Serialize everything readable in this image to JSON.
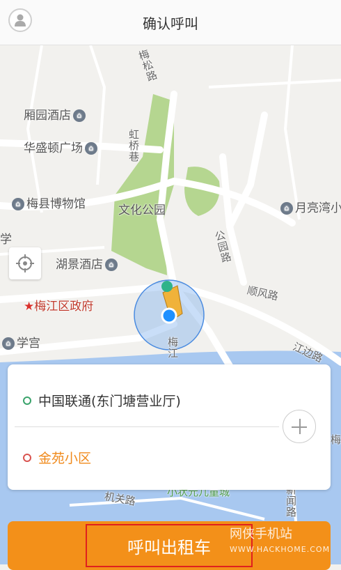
{
  "header": {
    "title": "确认呼叫",
    "avatar_icon": "user-icon"
  },
  "map": {
    "pois": [
      {
        "label": "厢园酒店",
        "icon": "hotel-icon"
      },
      {
        "label": "华盛顿广场",
        "icon": "landmark-icon"
      },
      {
        "label": "梅县博物馆",
        "icon": "museum-icon"
      },
      {
        "label": "文化公园",
        "icon": "park-icon"
      },
      {
        "label": "月亮湾小",
        "icon": "landmark-icon"
      },
      {
        "label": "湖景酒店",
        "icon": "hotel-icon"
      },
      {
        "label": "梅江区政府",
        "icon": "government-star-icon"
      },
      {
        "label": "学宫",
        "icon": "museum-icon"
      },
      {
        "label": "学",
        "icon": "school-icon"
      }
    ],
    "roads": {
      "meisong": "梅松路",
      "hongqiao": "虹桥巷",
      "gongyuan": "公园路",
      "shunfeng": "顺风路",
      "jiangbian": "江边路",
      "meijiang": "梅江",
      "jiguan": "机关路",
      "xinwen": "新闻路",
      "children": "小状元儿童城",
      "mei_right": "梅"
    },
    "locate_icon": "locate-crosshair-icon"
  },
  "route_card": {
    "from": "中国联通(东门塘营业厅)",
    "to": "金苑小区",
    "add_icon": "plus-icon"
  },
  "call_button": {
    "label": "呼叫出租车"
  },
  "watermark": {
    "text": "网侠手机站",
    "url": "WWW.HACKHOME.COM"
  },
  "colors": {
    "accent": "#f39019",
    "destination": "#f08a1c",
    "origin_dot": "#3aa36b",
    "dest_dot": "#d9534f",
    "park": "#b5d690",
    "water": "#a8c8f0"
  }
}
